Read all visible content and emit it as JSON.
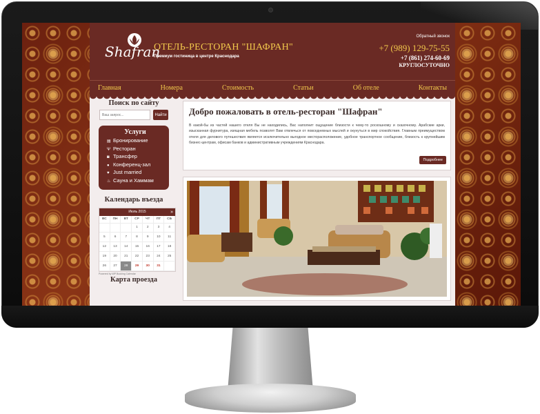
{
  "logo": {
    "text": "Shafran"
  },
  "header": {
    "hotel_name": "ОТЕЛЬ-РЕСТОРАН \"ШАФРАН\"",
    "tagline": "Премиум гостиница в центре Краснодара",
    "callback_label": "Обратный звонок",
    "phone_primary": "+7 (989) 129-75-55",
    "phone_secondary": "+7 (861) 274-60-69",
    "hours": "КРУГЛОСУТОЧНО"
  },
  "nav": {
    "items": [
      "Главная",
      "Номера",
      "Стоимость",
      "Статьи",
      "Об отеле",
      "Контакты"
    ]
  },
  "search": {
    "title": "Поиск по сайту",
    "placeholder": "Ваш запрос...",
    "button": "Найти"
  },
  "services": {
    "title": "Услуги",
    "items": [
      {
        "label": "Бронирование",
        "icon": "book-icon"
      },
      {
        "label": "Ресторан",
        "icon": "fork-knife-icon"
      },
      {
        "label": "Трансфер",
        "icon": "car-icon"
      },
      {
        "label": "Конференц-зал",
        "icon": "group-icon"
      },
      {
        "label": "Just married",
        "icon": "heart-icon"
      },
      {
        "label": "Сауна и Хаммам",
        "icon": "flame-icon"
      }
    ]
  },
  "calendar": {
    "title": "Календарь въезда",
    "month": "Июль 2015",
    "weekdays": [
      "ВС",
      "ПН",
      "ВТ",
      "СР",
      "ЧТ",
      "ПТ",
      "СБ"
    ],
    "days": [
      "",
      "",
      "",
      "1",
      "2",
      "3",
      "4",
      "5",
      "6",
      "7",
      "8",
      "9",
      "10",
      "11",
      "12",
      "13",
      "14",
      "15",
      "16",
      "17",
      "18",
      "19",
      "20",
      "21",
      "22",
      "23",
      "24",
      "25",
      "26",
      "27",
      "28",
      "29",
      "30",
      "31",
      ""
    ],
    "today": "28",
    "booked": [
      "29",
      "30",
      "31"
    ],
    "powered": "Powered by WP Booking Calendar"
  },
  "map": {
    "title": "Карта проезда"
  },
  "welcome": {
    "title": "Добро пожаловать в отель-ресторан \"Шафран\"",
    "text": "В какой-бы из частей нашего отеля Вы не находились, Вас наполнит ощущение близости к чему-то роскошному и сказочному. Арабские арки, изысканная фурнитура, изящная мебель позволят Вам отвлечься от повседневных мыслей и окунуться в мир спокойствия. Главным преимуществом отеля для делового путешествия является исключительно выгодное месторасположение, удобное транспортное сообщение, близость к крупнейшим бизнес-центрам, офисам банков и административным учреждениям Краснодара.",
    "button": "Подробнее"
  },
  "colors": {
    "brand": "#6a2a24",
    "accent": "#f2c94c",
    "background": "#f3eded"
  }
}
